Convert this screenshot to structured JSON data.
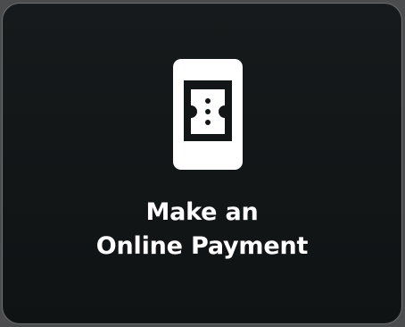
{
  "card": {
    "title_line1": "Make an",
    "title_line2": "Online Payment",
    "icon": "mobile-ticket-icon"
  },
  "colors": {
    "card_background": "#131718",
    "card_border": "#6b6e70",
    "text": "#ffffff",
    "icon": "#ffffff"
  }
}
